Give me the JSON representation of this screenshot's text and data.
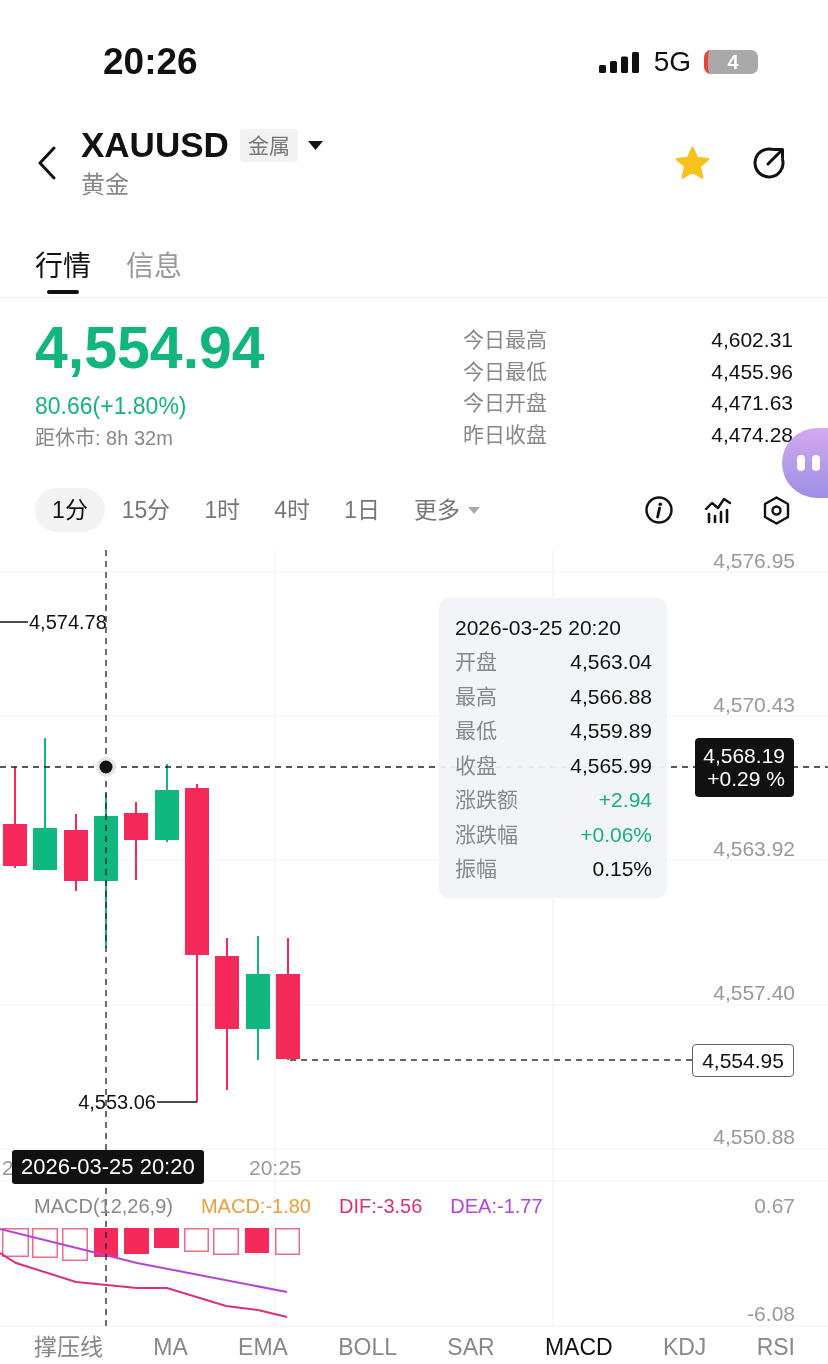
{
  "status_bar": {
    "time": "20:26",
    "network": "5G",
    "battery": "4"
  },
  "header": {
    "symbol": "XAUUSD",
    "category_badge": "金属",
    "name": "黄金",
    "favorite": true
  },
  "tabs": [
    {
      "label": "行情",
      "selected": true
    },
    {
      "label": "信息",
      "selected": false
    }
  ],
  "quote": {
    "price": "4,554.94",
    "change": "80.66(+1.80%)",
    "close_countdown": "距休市: 8h 32m",
    "stats": [
      {
        "label": "今日最高",
        "value": "4,602.31"
      },
      {
        "label": "今日最低",
        "value": "4,455.96"
      },
      {
        "label": "今日开盘",
        "value": "4,471.63"
      },
      {
        "label": "昨日收盘",
        "value": "4,474.28"
      }
    ]
  },
  "timeframes": [
    {
      "label": "1分",
      "selected": true
    },
    {
      "label": "15分",
      "selected": false
    },
    {
      "label": "1时",
      "selected": false
    },
    {
      "label": "4时",
      "selected": false
    },
    {
      "label": "1日",
      "selected": false
    }
  ],
  "more_menu": {
    "label": "更多"
  },
  "chart": {
    "y_labels": [
      "4,576.95",
      "4,570.43",
      "4,563.92",
      "4,557.40",
      "4,550.88"
    ],
    "high_marker": "4,574.78",
    "low_marker": "4,553.06",
    "crosshair_price": "4,568.19",
    "crosshair_change": "+0.29 %",
    "last_price": "4,554.95",
    "x_labels": [
      "2",
      "20:25"
    ],
    "crosshair_time": "2026-03-25 20:20",
    "tooltip": {
      "time": "2026-03-25 20:20",
      "rows": [
        {
          "label": "开盘",
          "value": "4,563.04",
          "kind": "plain"
        },
        {
          "label": "最高",
          "value": "4,566.88",
          "kind": "plain"
        },
        {
          "label": "最低",
          "value": "4,559.89",
          "kind": "plain"
        },
        {
          "label": "收盘",
          "value": "4,565.99",
          "kind": "plain"
        },
        {
          "label": "涨跌额",
          "value": "+2.94",
          "kind": "change"
        },
        {
          "label": "涨跌幅",
          "value": "+0.06%",
          "kind": "change"
        },
        {
          "label": "振幅",
          "value": "0.15%",
          "kind": "plain"
        }
      ]
    }
  },
  "macd": {
    "title": "MACD(12,26,9)",
    "values": [
      {
        "label": "MACD:-1.80",
        "color": "#e9a03a"
      },
      {
        "label": "DIF:-3.56",
        "color": "#dc2f7a"
      },
      {
        "label": "DEA:-1.77",
        "color": "#b444d8"
      }
    ],
    "y_labels": [
      "0.67",
      "-6.08"
    ]
  },
  "indicator_tabs": [
    {
      "label": "撑压线",
      "selected": false
    },
    {
      "label": "MA",
      "selected": false
    },
    {
      "label": "EMA",
      "selected": false
    },
    {
      "label": "BOLL",
      "selected": false
    },
    {
      "label": "SAR",
      "selected": false
    },
    {
      "label": "MACD",
      "selected": true
    },
    {
      "label": "KDJ",
      "selected": false
    },
    {
      "label": "RSI",
      "selected": false
    }
  ]
}
